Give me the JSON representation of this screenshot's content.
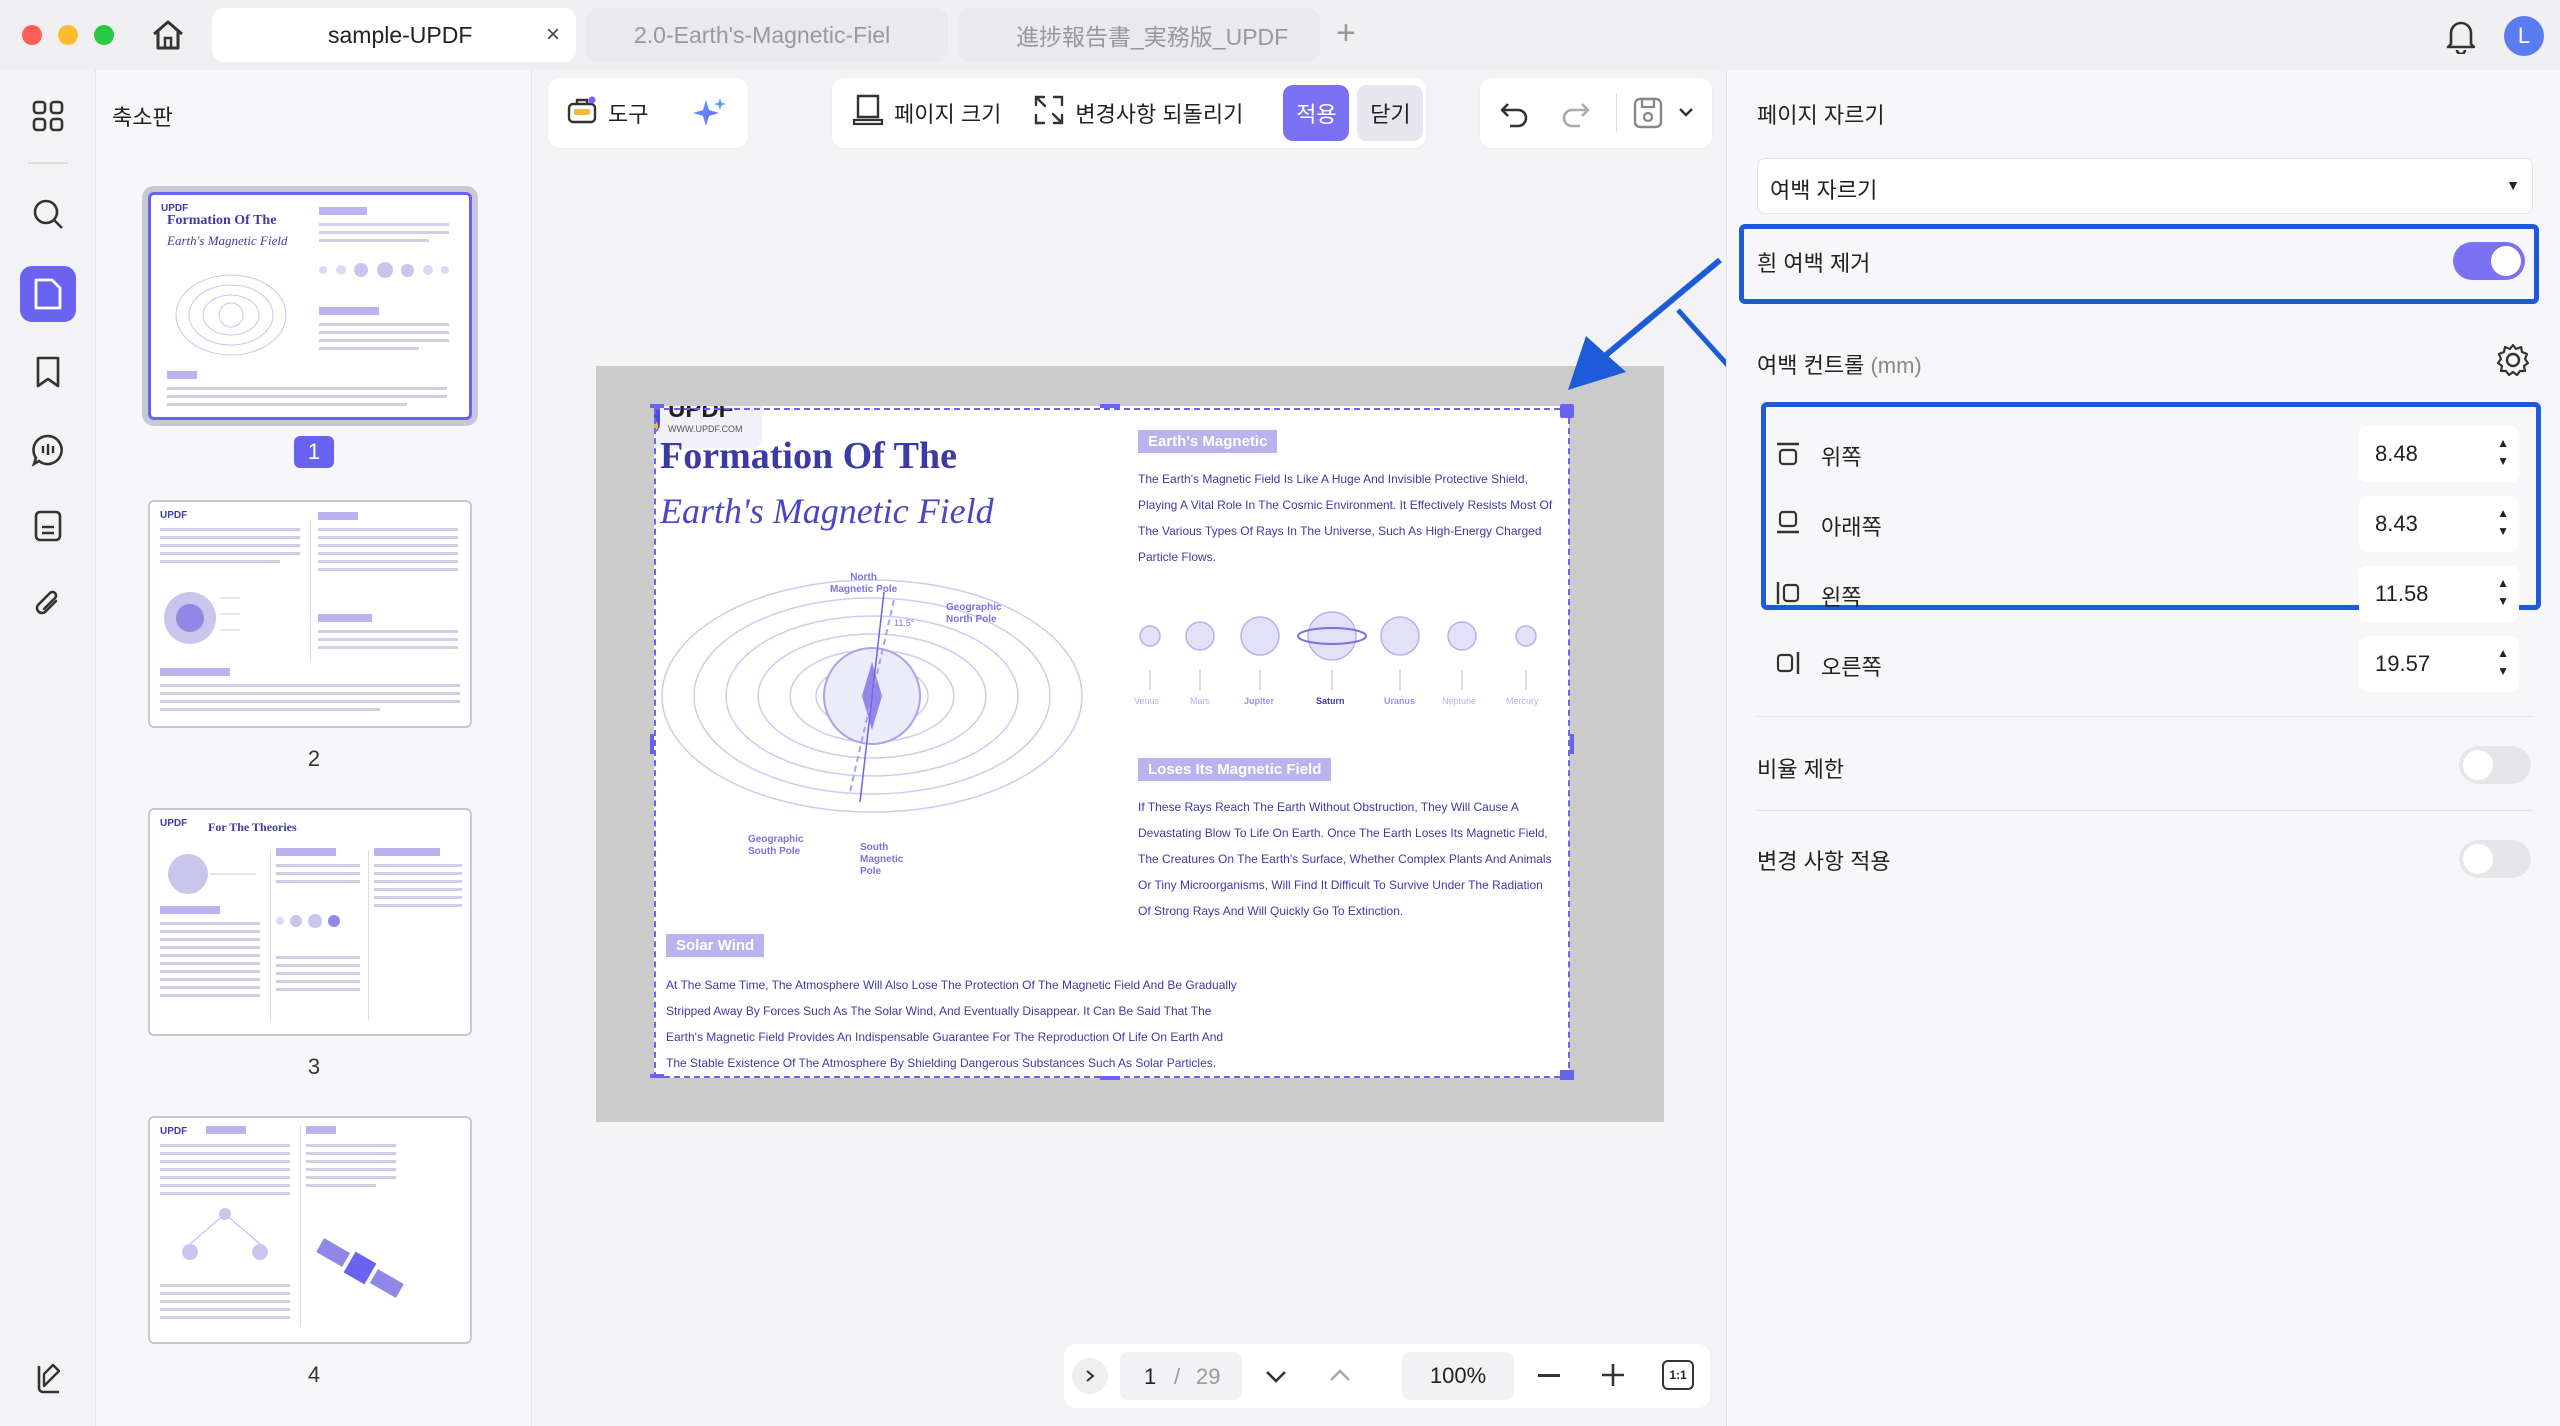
{
  "window": {
    "tabs": [
      {
        "label": "sample-UPDF",
        "close": "×"
      },
      {
        "label": "2.0-Earth's-Magnetic-Fiel"
      },
      {
        "label": "進捗報告書_実務版_UPDF"
      }
    ],
    "add_tab": "+",
    "avatar_letter": "L"
  },
  "thumbnails": {
    "title": "축소판",
    "pages": [
      "1",
      "2",
      "3",
      "4"
    ]
  },
  "toolbar": {
    "tools_label": "도구",
    "page_size_label": "페이지 크기",
    "revert_label": "변경사항 되돌리기",
    "apply_label": "적용",
    "close_label": "닫기"
  },
  "document": {
    "logo": "UPDF",
    "logo_url": "WWW.UPDF.COM",
    "title_line1": "Formation Of The",
    "title_line2": "Earth's Magnetic Field",
    "diagram_labels": {
      "north_magnetic": "North\nMagnetic Pole",
      "geo_north": "Geographic\nNorth Pole",
      "geo_south": "Geographic\nSouth Pole",
      "south_magnetic": "South\nMagnetic\nPole",
      "angle": "11.5°"
    },
    "section1_heading": "Earth's Magnetic",
    "section1_text": "The Earth's Magnetic Field Is Like A Huge And Invisible Protective Shield, Playing A Vital Role In The Cosmic Environment. It Effectively Resists Most Of The Various Types Of Rays In The Universe, Such As High-Energy Charged Particle Flows.",
    "planets": [
      "Venus",
      "Mars",
      "Jupiter",
      "Saturn",
      "Uranus",
      "Neptune",
      "Mercury"
    ],
    "section2_heading": "Loses Its Magnetic Field",
    "section2_text": "If These Rays Reach The Earth Without Obstruction, They Will Cause A Devastating Blow To Life On Earth. Once The Earth Loses Its Magnetic Field, The Creatures On The Earth's Surface, Whether Complex Plants And Animals Or Tiny Microorganisms, Will Find It Difficult To Survive Under The Radiation Of Strong Rays And Will Quickly Go To Extinction.",
    "section3_heading": "Solar Wind",
    "section3_text": "At The Same Time, The Atmosphere Will Also Lose The Protection Of The Magnetic Field And Be Gradually Stripped Away By Forces Such As The Solar Wind, And Eventually Disappear. It Can Be Said That The Earth's Magnetic Field Provides An Indispensable Guarantee For The Reproduction Of Life On Earth And The Stable Existence Of The Atmosphere By Shielding Dangerous Substances Such As Solar Particles.",
    "thumb3_title": "For The Theories"
  },
  "right_panel": {
    "title": "페이지 자르기",
    "mode_select": "여백 자르기",
    "remove_white_label": "흰 여백 제거",
    "remove_white_on": true,
    "margin_title": "여백 컨트롤",
    "margin_unit": "(mm)",
    "margins": [
      {
        "label": "위쪽",
        "value": "8.48"
      },
      {
        "label": "아래쪽",
        "value": "8.43"
      },
      {
        "label": "왼쪽",
        "value": "11.58"
      },
      {
        "label": "오른쪽",
        "value": "19.57"
      }
    ],
    "ratio_label": "비율 제한",
    "ratio_on": false,
    "apply_changes_label": "변경 사항 적용",
    "apply_changes_on": false
  },
  "page_nav": {
    "current": "1",
    "separator": "/",
    "total": "29",
    "zoom": "100%",
    "fit_label": "1:1"
  },
  "colors": {
    "accent": "#6a63f0",
    "highlight": "#1e5bd8",
    "doc_text": "#3c3ca6"
  }
}
